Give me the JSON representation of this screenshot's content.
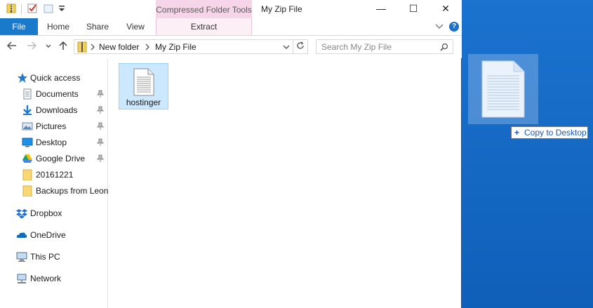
{
  "window": {
    "title": "My Zip File",
    "contextual_tab": "Compressed Folder Tools",
    "controls": {
      "minimize": "—",
      "maximize": "☐",
      "close": "✕"
    }
  },
  "ribbon": {
    "tabs": [
      {
        "label": "File"
      },
      {
        "label": "Home"
      },
      {
        "label": "Share"
      },
      {
        "label": "View"
      },
      {
        "label": "Extract"
      }
    ],
    "help": "?"
  },
  "address": {
    "breadcrumbs": [
      "New folder",
      "My Zip File"
    ],
    "search_placeholder": "Search My Zip File"
  },
  "nav": {
    "items": [
      {
        "label": "Quick access",
        "icon": "star-icon"
      },
      {
        "label": "Documents",
        "icon": "documents-icon",
        "pinned": true
      },
      {
        "label": "Downloads",
        "icon": "download-icon",
        "pinned": true
      },
      {
        "label": "Pictures",
        "icon": "pictures-icon",
        "pinned": true
      },
      {
        "label": "Desktop",
        "icon": "desktop-icon",
        "pinned": true
      },
      {
        "label": "Google Drive",
        "icon": "google-drive-icon",
        "pinned": true
      },
      {
        "label": "20161221",
        "icon": "folder-icon"
      },
      {
        "label": "Backups from Leon",
        "icon": "folder-icon"
      },
      {
        "label": "Dropbox",
        "icon": "dropbox-icon"
      },
      {
        "label": "OneDrive",
        "icon": "onedrive-icon"
      },
      {
        "label": "This PC",
        "icon": "this-pc-icon"
      },
      {
        "label": "Network",
        "icon": "network-icon"
      }
    ]
  },
  "content": {
    "files": [
      {
        "name": "hostinger",
        "icon": "document-icon",
        "selected": true
      }
    ]
  },
  "drag": {
    "tooltip_symbol": "+",
    "tooltip": "Copy to Desktop"
  },
  "colors": {
    "accent": "#1979ca",
    "selection": "#cce8ff",
    "contextual_tab": "#f6d5e8",
    "desktop": "#1467c2"
  }
}
